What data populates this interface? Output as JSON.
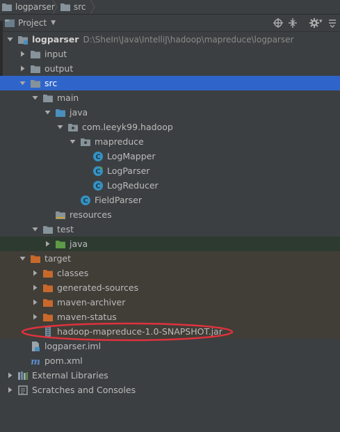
{
  "breadcrumb": {
    "root": "logparser",
    "child": "src"
  },
  "toolbar": {
    "view_label": "Project"
  },
  "tree": {
    "root": {
      "name": "logparser",
      "path": "D:\\SheIn\\Java\\IntelliJ\\hadoop\\mapreduce\\logparser"
    },
    "input": "input",
    "output": "output",
    "src": "src",
    "main": "main",
    "java": "java",
    "package": "com.leeyk99.hadoop",
    "mapreduce": "mapreduce",
    "log_mapper": "LogMapper",
    "log_parser": "LogParser",
    "log_reducer": "LogReducer",
    "field_parser": "FieldParser",
    "resources": "resources",
    "test": "test",
    "test_java": "java",
    "target": "target",
    "classes": "classes",
    "generated_sources": "generated-sources",
    "maven_archiver": "maven-archiver",
    "maven_status": "maven-status",
    "jar": "hadoop-mapreduce-1.0-SNAPSHOT.jar",
    "iml": "logparser.iml",
    "pom": "pom.xml",
    "external_libraries": "External Libraries",
    "scratches": "Scratches and Consoles"
  },
  "colors": {
    "background": "#3c3f41",
    "selection": "#2f65ca",
    "folder": "#87939a",
    "source_folder": "#4a8fbd",
    "test_folder": "#5e9a48",
    "excluded_folder": "#c8692b",
    "class_icon": "#3592c4",
    "highlight_oval": "#e0323d"
  }
}
